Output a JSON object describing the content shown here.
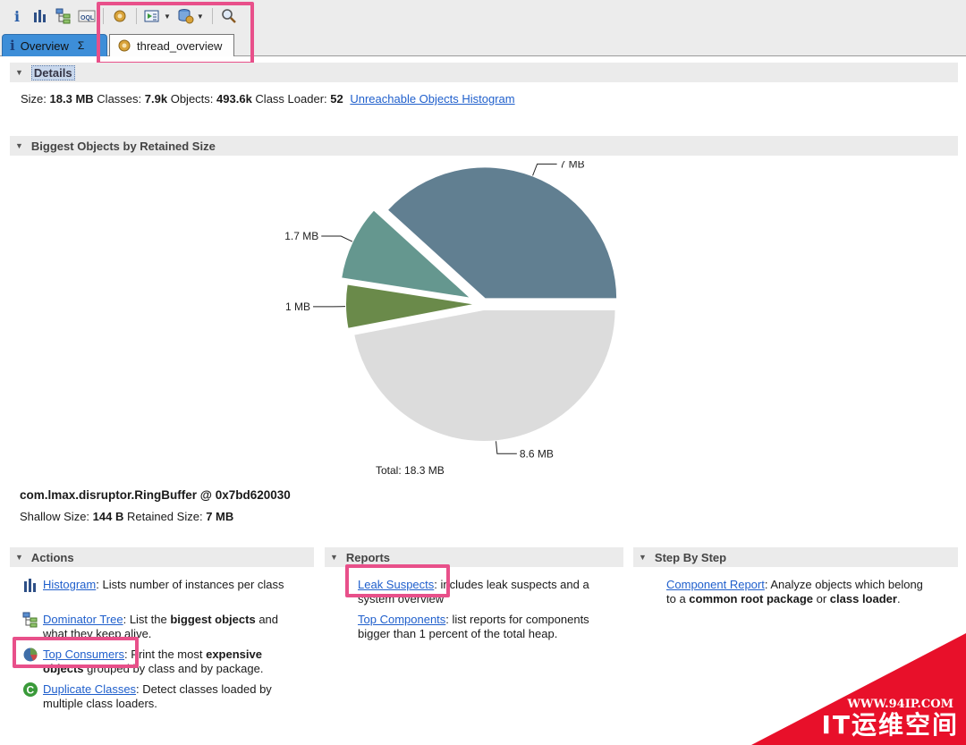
{
  "toolbar": {
    "buttons": [
      "info-icon",
      "histogram-icon",
      "dominator-tree-icon",
      "oql-icon",
      "thread-overview-icon",
      "run-report-icon",
      "query-browser-icon",
      "search-icon"
    ],
    "oql_label": "OQL"
  },
  "tabs": [
    {
      "label": "Overview",
      "icon": "info-icon",
      "active": true
    },
    {
      "label": "thread_overview",
      "icon": "gear-icon",
      "active": false
    }
  ],
  "details": {
    "title": "Details",
    "size_label": "Size:",
    "size_value": "18.3 MB",
    "classes_label": "Classes:",
    "classes_value": "7.9k",
    "objects_label": "Objects:",
    "objects_value": "493.6k",
    "loader_label": "Class Loader:",
    "loader_value": "52",
    "histogram_link": "Unreachable Objects Histogram"
  },
  "biggest": {
    "title": "Biggest Objects by Retained Size",
    "total_label": "Total: 18.3 MB",
    "object_name": "com.lmax.disruptor.RingBuffer @ 0x7bd620030",
    "shallow_label": "Shallow Size:",
    "shallow_value": "144 B",
    "retained_label": "Retained Size:",
    "retained_value": "7 MB"
  },
  "chart_data": {
    "type": "pie",
    "slices": [
      {
        "label": "7 MB",
        "value": 7,
        "color": "#617f91"
      },
      {
        "label": "1.7 MB",
        "value": 1.7,
        "color": "#65978f"
      },
      {
        "label": "1 MB",
        "value": 1,
        "color": "#6a8a4a"
      },
      {
        "label": "8.6 MB",
        "value": 8.6,
        "color": "#dcdcdc"
      }
    ],
    "total": "Total: 18.3 MB"
  },
  "actions": {
    "title": "Actions",
    "items": [
      {
        "icon": "histogram-icon",
        "link": "Histogram",
        "text": ": Lists number of instances per class"
      },
      {
        "icon": "dominator-tree-icon",
        "link": "Dominator Tree",
        "text_a": ": List the ",
        "bold": "biggest objects",
        "text_b": " and what they keep alive."
      },
      {
        "icon": "pie-chart-icon",
        "link": "Top Consumers",
        "text_a": ": Print the most ",
        "bold": "expensive objects",
        "text_b": " grouped by class and by package."
      },
      {
        "icon": "duplicate-classes-icon",
        "link": "Duplicate Classes",
        "text": ": Detect classes loaded by multiple class loaders."
      }
    ]
  },
  "reports": {
    "title": "Reports",
    "items": [
      {
        "link": "Leak Suspects",
        "text": ": includes leak suspects and a system overview"
      },
      {
        "link": "Top Components",
        "text": ": list reports for components bigger than 1 percent of the total heap."
      }
    ]
  },
  "steps": {
    "title": "Step By Step",
    "items": [
      {
        "link": "Component Report",
        "text_a": ": Analyze objects which belong to a ",
        "bold_a": "common root package",
        "text_b": " or ",
        "bold_b": "class loader",
        "text_c": "."
      }
    ]
  },
  "watermark": {
    "line1": "WWW.94IP.COM",
    "line2": "IT运维空间"
  }
}
